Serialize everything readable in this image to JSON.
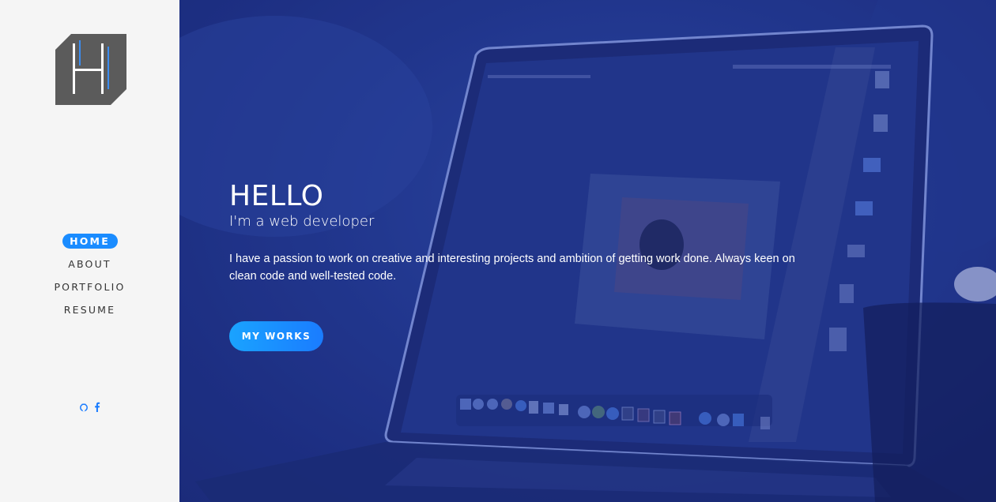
{
  "logo": {
    "letter": "H"
  },
  "nav": {
    "items": [
      {
        "label": "HOME",
        "active": true
      },
      {
        "label": "ABOUT"
      },
      {
        "label": "PORTFOLIO"
      },
      {
        "label": "RESUME"
      }
    ]
  },
  "socials": [
    {
      "icon": "github-icon"
    },
    {
      "icon": "facebook-icon"
    }
  ],
  "hero": {
    "title": "HELLO",
    "subtitle": "I'm a web developer",
    "description": "I have a passion to work on creative and interesting projects and ambition of getting work done. Always keen on clean code and well-tested code.",
    "cta_label": "MY WORKS"
  },
  "colors": {
    "accent": "#1a8cff",
    "hero_overlay": "#1f3389",
    "sidebar_bg": "#f5f5f5"
  }
}
